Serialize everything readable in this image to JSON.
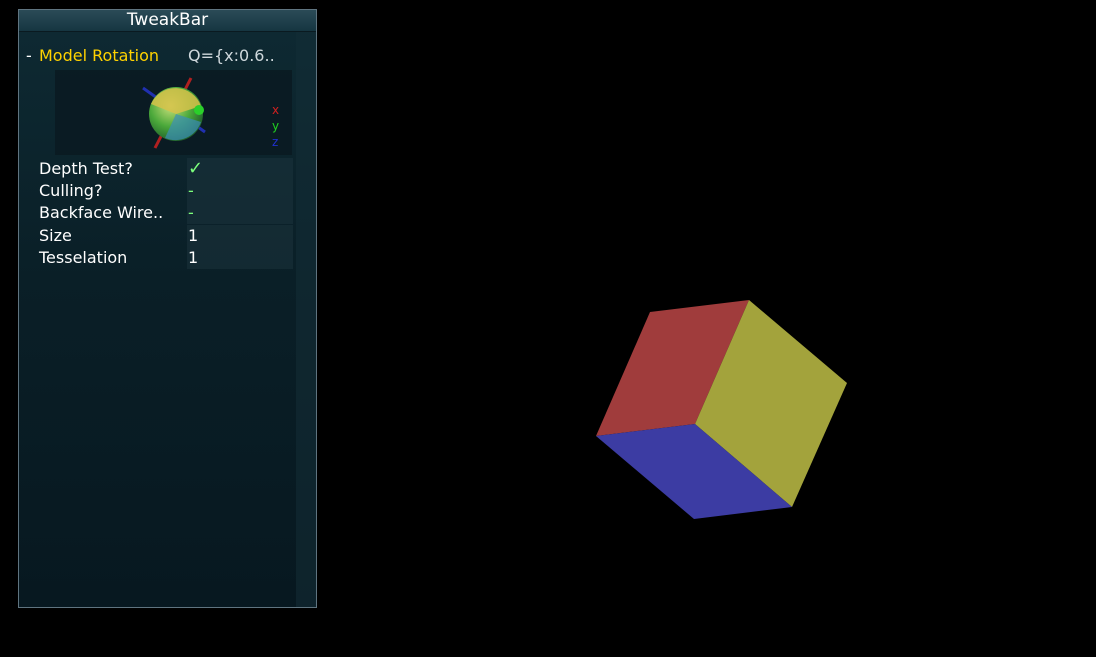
{
  "tweakbar": {
    "title": "TweakBar",
    "rotation": {
      "collapse_symbol": "-",
      "label": "Model Rotation",
      "value": "Q={x:0.6..",
      "axes": {
        "x": "x",
        "y": "y",
        "z": "z"
      }
    },
    "params": [
      {
        "label": "Depth Test?",
        "value": "✓",
        "kind": "check"
      },
      {
        "label": "Culling?",
        "value": "-",
        "kind": "dash"
      },
      {
        "label": "Backface Wire..",
        "value": "-",
        "kind": "dash"
      },
      {
        "label": "Size",
        "value": "1",
        "kind": "num"
      },
      {
        "label": "Tesselation",
        "value": "1",
        "kind": "num"
      }
    ]
  },
  "scene": {
    "object": "cube",
    "face_colors": {
      "left": "#a03c3c",
      "right": "#a3a33c",
      "bottom": "#3c3ca3"
    }
  }
}
